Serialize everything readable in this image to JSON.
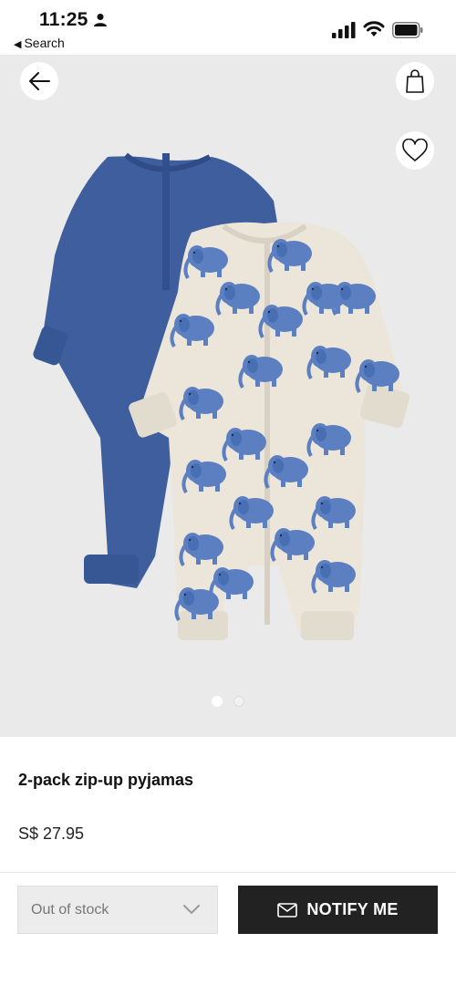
{
  "status_bar": {
    "time": "11:25",
    "back_app_label": "Search"
  },
  "gallery": {
    "slide_count": 2,
    "active_slide": 1,
    "colors": {
      "background": "#eaeaea",
      "navy_romper": "#3f5e9e",
      "print_romper": "#ece6da",
      "elephant": "#5b7fc1"
    }
  },
  "product": {
    "title": "2-pack zip-up pyjamas",
    "price": "S$ 27.95"
  },
  "actions": {
    "stock_status": "Out of stock",
    "notify_label": "NOTIFY ME"
  },
  "icons": {
    "back": "arrow-left-icon",
    "bag": "shopping-bag-icon",
    "favorite": "heart-icon",
    "mail": "envelope-icon",
    "dropdown": "chevron-down-icon"
  }
}
